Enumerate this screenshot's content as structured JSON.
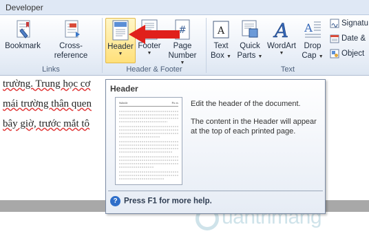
{
  "tabs": {
    "active": "Developer"
  },
  "ribbon": {
    "links": {
      "label": "Links",
      "bookmark": "Bookmark",
      "cross_reference": "Cross-reference"
    },
    "header_footer": {
      "label": "Header & Footer",
      "header": "Header",
      "footer": "Footer",
      "page_number_1": "Page",
      "page_number_2": "Number"
    },
    "text": {
      "label": "Text",
      "text_box_1": "Text",
      "text_box_2": "Box",
      "quick_parts_1": "Quick",
      "quick_parts_2": "Parts",
      "wordart": "WordArt",
      "drop_cap_1": "Drop",
      "drop_cap_2": "Cap",
      "signature": "Signatu",
      "date": "Date &",
      "object": "Object"
    },
    "caret": "▼"
  },
  "document": {
    "lines": [
      "trường. Trung học cơ",
      "mái trường thân quen",
      "bây giờ, trước mắt tô"
    ]
  },
  "tooltip": {
    "title": "Header",
    "desc1": "Edit the header of the document.",
    "desc2": "The content in the Header will appear at the top of each printed page.",
    "help": "Press F1 for more help.",
    "thumb_left": "Subtitle",
    "thumb_right": "Pic es"
  },
  "watermark": {
    "text": "uantrimang"
  },
  "colors": {
    "arrow": "#e0201b",
    "accent": "#2e6ec9"
  }
}
